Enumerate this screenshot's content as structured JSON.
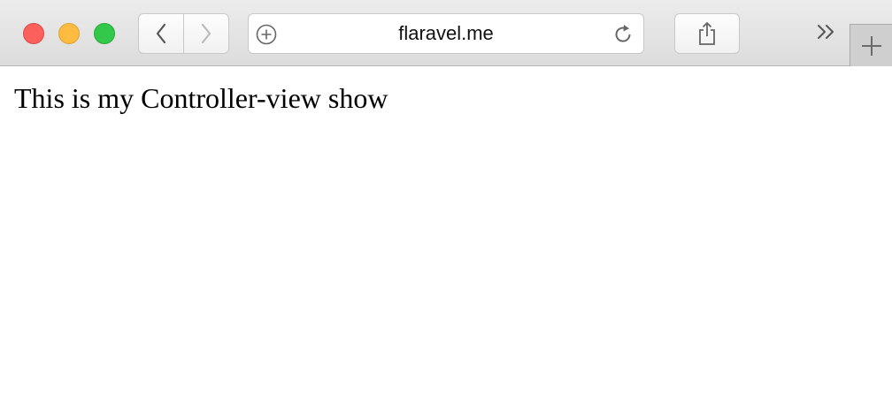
{
  "window": {
    "controls": [
      "close",
      "minimize",
      "zoom"
    ]
  },
  "toolbar": {
    "back_icon": "chevron-left-icon",
    "forward_icon": "chevron-right-icon",
    "address": {
      "url": "flaravel.me",
      "left_icon": "add-circle-icon",
      "right_icon": "reload-icon"
    },
    "share_icon": "share-icon",
    "more_icon": "double-chevron-right-icon",
    "new_tab_icon": "plus-icon"
  },
  "page": {
    "body_text": "This is my Controller-view show"
  },
  "colors": {
    "close": "#fc605c",
    "minimize": "#fdbc40",
    "zoom": "#34c84a"
  }
}
